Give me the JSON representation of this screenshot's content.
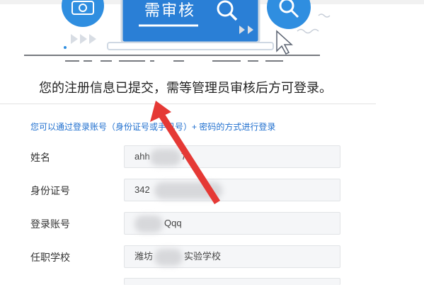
{
  "illustration": {
    "screen_text": "需审核",
    "icons": [
      "camera-icon",
      "search-icon",
      "verify-search-icon",
      "cursor-icon"
    ]
  },
  "notice": {
    "text": "您的注册信息已提交，需等管理员审核后方可登录。"
  },
  "login_hint": {
    "text": "您可以通过登录账号（身份证号或手机号）+ 密码的方式进行登录"
  },
  "form": {
    "name": {
      "label": "姓名",
      "value_start": "ahh",
      "value_end": "7"
    },
    "id_number": {
      "label": "身份证号",
      "value_start": "342",
      "value_end": ""
    },
    "account": {
      "label": "登录账号",
      "value_start": "",
      "value_end": "Qqq"
    },
    "school": {
      "label": "任职学校",
      "value_start": "潍坊",
      "value_end": "实验学校"
    }
  },
  "colors": {
    "accent_blue": "#2e86de",
    "hint_blue": "#1f6fcf",
    "arrow_red": "#e53935",
    "field_bg": "#f5f6f8"
  }
}
